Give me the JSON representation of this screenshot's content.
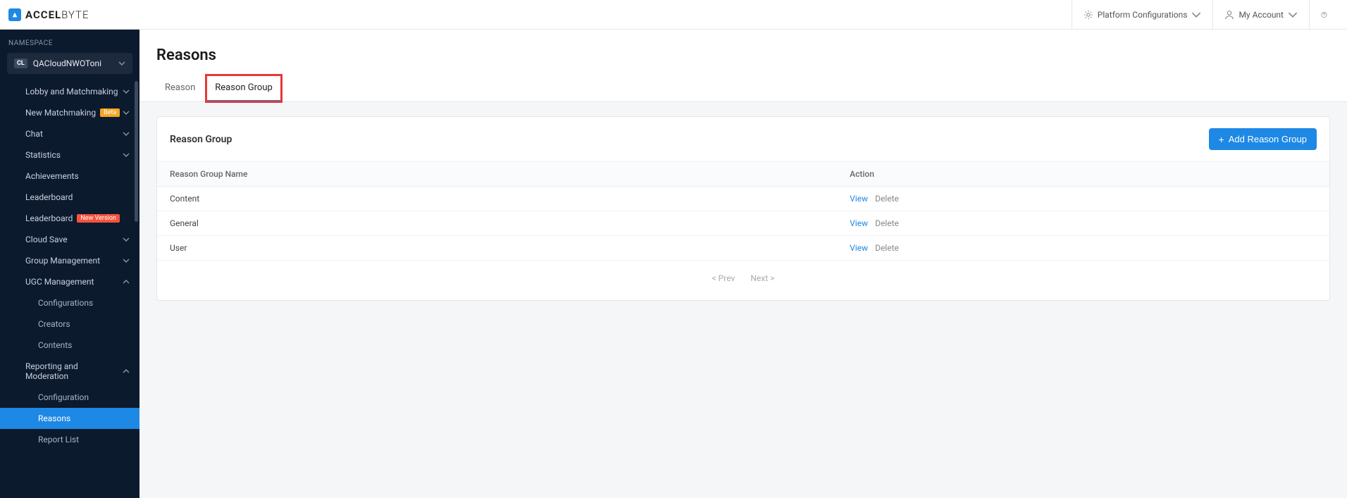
{
  "header": {
    "logo_bold": "ACCEL",
    "logo_light": "BYTE",
    "platform_config": "Platform Configurations",
    "my_account": "My Account"
  },
  "sidebar": {
    "section_label": "NAMESPACE",
    "namespace_badge": "CL",
    "namespace_name": "QACloudNWOToni",
    "items": [
      {
        "label": "Lobby and Matchmaking",
        "type": "top",
        "chev": "down"
      },
      {
        "label": "New Matchmaking",
        "type": "top",
        "badge": "Beta",
        "chev": "down"
      },
      {
        "label": "Chat",
        "type": "top",
        "chev": "down"
      },
      {
        "label": "Statistics",
        "type": "top",
        "chev": "down"
      },
      {
        "label": "Achievements",
        "type": "top"
      },
      {
        "label": "Leaderboard",
        "type": "top"
      },
      {
        "label": "Leaderboard",
        "type": "top",
        "badge": "New Version"
      },
      {
        "label": "Cloud Save",
        "type": "top",
        "chev": "down"
      },
      {
        "label": "Group Management",
        "type": "top",
        "chev": "down"
      },
      {
        "label": "UGC Management",
        "type": "top",
        "chev": "up"
      },
      {
        "label": "Configurations",
        "type": "sub"
      },
      {
        "label": "Creators",
        "type": "sub"
      },
      {
        "label": "Contents",
        "type": "sub"
      },
      {
        "label": "Reporting and Moderation",
        "type": "top",
        "chev": "up"
      },
      {
        "label": "Configuration",
        "type": "sub"
      },
      {
        "label": "Reasons",
        "type": "sub",
        "active": true
      },
      {
        "label": "Report List",
        "type": "sub"
      }
    ]
  },
  "page": {
    "title": "Reasons",
    "tabs": [
      {
        "label": "Reason",
        "active": false
      },
      {
        "label": "Reason Group",
        "active": true,
        "highlighted": true
      }
    ]
  },
  "panel": {
    "title": "Reason Group",
    "add_button": "Add Reason Group",
    "columns": [
      "Reason Group Name",
      "Action"
    ],
    "rows": [
      {
        "name": "Content"
      },
      {
        "name": "General"
      },
      {
        "name": "User"
      }
    ],
    "action_view": "View",
    "action_delete": "Delete",
    "pagination": {
      "prev": "< Prev",
      "next": "Next >"
    }
  }
}
